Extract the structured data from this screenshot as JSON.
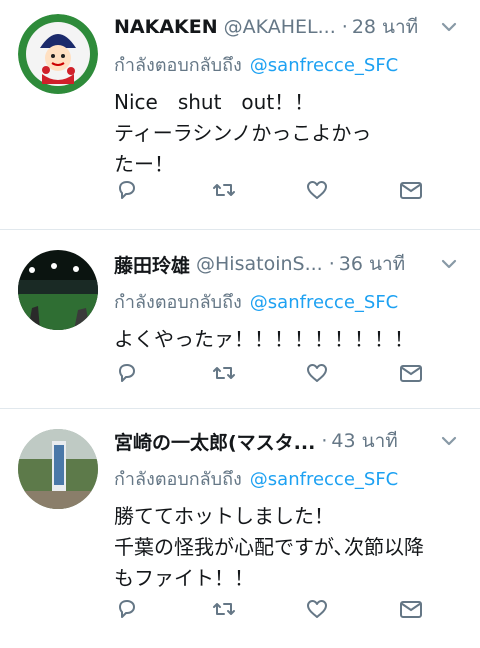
{
  "tweets": [
    {
      "name": "NAKAKEN",
      "handle": "@AKAHEL...",
      "time": "28 นาที",
      "reply_label": "กำลังตอบกลับถึง",
      "reply_to": "@sanfrecce_SFC",
      "text": "Nice　shut　out！！\nティーラシンノかっこよかっ\nたー！",
      "avatar": "cartoon-mascot-avatar"
    },
    {
      "name": "藤田玲雄",
      "handle": "@HisatoinS...",
      "time": "36 นาที",
      "reply_label": "กำลังตอบกลับถึง",
      "reply_to": "@sanfrecce_SFC",
      "text": "よくやったァ！！！！！！！！！",
      "avatar": "stadium-photo-avatar"
    },
    {
      "name": "宮崎の一太郎(マスタ...",
      "handle": "",
      "time": "43 นาที",
      "reply_label": "กำลังตอบกลับถึง",
      "reply_to": "@sanfrecce_SFC",
      "text": "勝ててホットしました！\n千葉の怪我が心配ですが､次節以降\nもファイト！！",
      "avatar": "signpost-photo-avatar"
    }
  ],
  "separator": "·",
  "colors": {
    "link": "#1da1f2",
    "secondary": "#657786",
    "divider": "#e1e8ed",
    "text": "#14171a"
  },
  "icons": {
    "reply": "reply-icon",
    "retweet": "retweet-icon",
    "like": "heart-icon",
    "dm": "envelope-icon",
    "menu": "chevron-down-icon"
  }
}
